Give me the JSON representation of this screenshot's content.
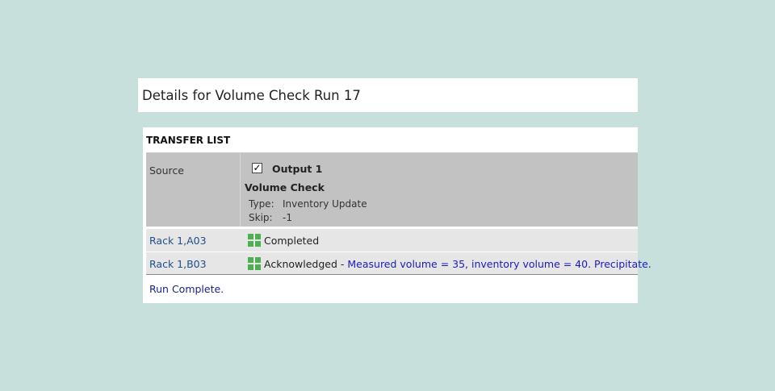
{
  "page": {
    "title": "Details for Volume Check Run 17"
  },
  "transfer_list": {
    "header": "TRANSFER LIST",
    "source_label": "Source",
    "output": {
      "checked": true,
      "label": "Output 1"
    },
    "step_name": "Volume Check",
    "details": [
      {
        "key": "Type:",
        "value": "Inventory Update"
      },
      {
        "key": "Skip:",
        "value": "-1"
      }
    ],
    "rows": [
      {
        "well": "Rack 1,A03",
        "status_icon": "grid-status-icon",
        "status": "Completed",
        "separator": "",
        "note": ""
      },
      {
        "well": "Rack 1,B03",
        "status_icon": "grid-status-icon",
        "status": "Acknowledged",
        "separator": " - ",
        "note": "Measured volume = 35, inventory volume = 40. Precipitate."
      }
    ],
    "footer": "Run Complete."
  },
  "colors": {
    "background": "#c8e0dc",
    "link": "#1f4f8a",
    "note": "#1a1ac0",
    "icon_green": "#4caf50"
  }
}
